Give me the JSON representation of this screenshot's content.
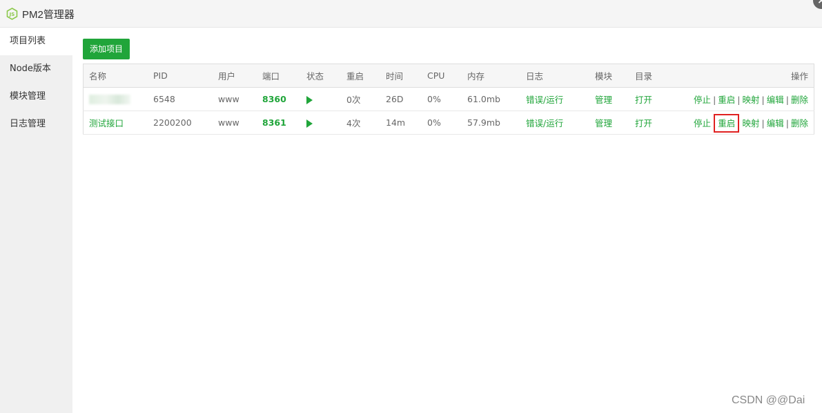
{
  "app": {
    "title": "PM2管理器"
  },
  "sidebar": {
    "items": [
      {
        "label": "项目列表"
      },
      {
        "label": "Node版本"
      },
      {
        "label": "模块管理"
      },
      {
        "label": "日志管理"
      }
    ]
  },
  "toolbar": {
    "add_label": "添加项目"
  },
  "table": {
    "headers": [
      "名称",
      "PID",
      "用户",
      "端口",
      "状态",
      "重启",
      "时间",
      "CPU",
      "内存",
      "日志",
      "模块",
      "目录",
      "操作"
    ],
    "rows": [
      {
        "name": "",
        "pid": "6548",
        "user": "www",
        "port": "8360",
        "restarts": "0次",
        "uptime": "26D",
        "cpu": "0%",
        "memory": "61.0mb",
        "log": "错误/运行",
        "module": "管理",
        "dir": "打开"
      },
      {
        "name": "测试接口",
        "pid": "2200200",
        "user": "www",
        "port": "8361",
        "restarts": "4次",
        "uptime": "14m",
        "cpu": "0%",
        "memory": "57.9mb",
        "log": "错误/运行",
        "module": "管理",
        "dir": "打开"
      }
    ],
    "actions": {
      "stop": "停止",
      "restart": "重启",
      "map": "映射",
      "edit": "编辑",
      "delete": "删除"
    },
    "separator": "|"
  },
  "icons": {
    "status": "play-icon",
    "logo": "nodejs-logo-icon",
    "close": "close-icon"
  },
  "colors": {
    "accent": "#20a53a",
    "highlight": "#e02020"
  },
  "watermark": "CSDN @@Dai"
}
